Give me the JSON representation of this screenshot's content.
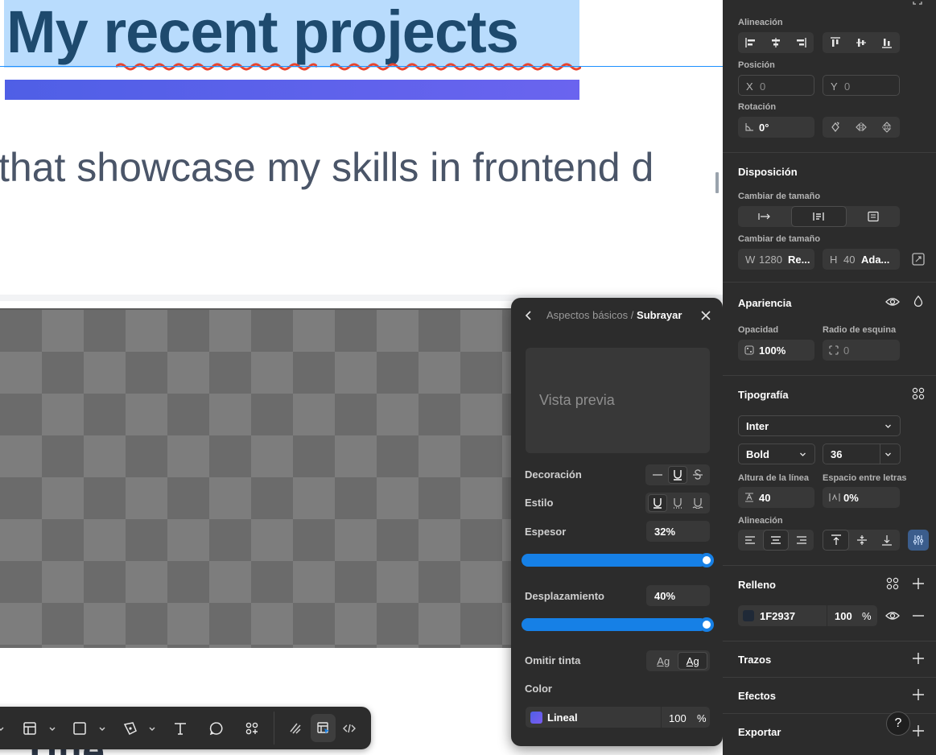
{
  "canvas": {
    "heading": "My recent projects",
    "subtitle": "that showcase my skills in frontend d",
    "bottom_title": "Title"
  },
  "toolbar": {
    "tools": [
      "move-tool",
      "frame-tool",
      "shape-tool",
      "pen-tool",
      "text-tool",
      "comment-tool",
      "actions-tool",
      "draw-mode",
      "design-mode",
      "dev-mode"
    ],
    "active_tool": "design-mode"
  },
  "popover": {
    "breadcrumb_parent": "Aspectos básicos",
    "breadcrumb_sep": "/",
    "breadcrumb_current": "Subrayar",
    "preview_text": "Vista previa",
    "decoration_label": "Decoración",
    "style_label": "Estilo",
    "thickness_label": "Espesor",
    "thickness_value": "32%",
    "thickness_fill": 1.0,
    "offset_label": "Desplazamiento",
    "offset_value": "40%",
    "offset_fill": 1.0,
    "skip_ink_label": "Omitir tinta",
    "skip_ink_options": [
      "Ag",
      "Ag"
    ],
    "color_label": "Color",
    "color_name": "Lineal",
    "color_opacity": "100",
    "color_opacity_unit": "%"
  },
  "panel": {
    "alignment_label": "Alineación",
    "position_label": "Posición",
    "x_prefix": "X",
    "x_value": "0",
    "y_prefix": "Y",
    "y_value": "0",
    "rotation_label": "Rotación",
    "rotation_value": "0°",
    "layout_heading": "Disposición",
    "resize_label_1": "Cambiar de tamaño",
    "resize_label_2": "Cambiar de tamaño",
    "w_prefix": "W",
    "w_value": "1280",
    "w_mode": "Re...",
    "h_prefix": "H",
    "h_value": "40",
    "h_mode": "Ada...",
    "appearance_heading": "Apariencia",
    "opacity_label": "Opacidad",
    "opacity_value": "100%",
    "radius_label": "Radio de esquina",
    "radius_value": "0",
    "typography_heading": "Tipografía",
    "font_family": "Inter",
    "font_weight": "Bold",
    "font_size": "36",
    "line_height_label": "Altura de la línea",
    "line_height_value": "40",
    "letter_spacing_label": "Espacio entre letras",
    "letter_spacing_value": "0%",
    "text_alignment_label": "Alineación",
    "fill_heading": "Relleno",
    "fill_hex": "1F2937",
    "fill_opacity": "100",
    "fill_opacity_unit": "%",
    "fill_color": "#1F2937",
    "strokes_heading": "Trazos",
    "effects_heading": "Efectos",
    "export_heading": "Exportar",
    "help_label": "?"
  },
  "colors": {
    "selection": "#b9dcfd",
    "heading_text": "#1e4a6e",
    "accent_blue": "#1680e6",
    "gradient_start": "#4f5fe6",
    "gradient_end": "#6a64ef",
    "panel_bg": "#2c2c2c"
  }
}
